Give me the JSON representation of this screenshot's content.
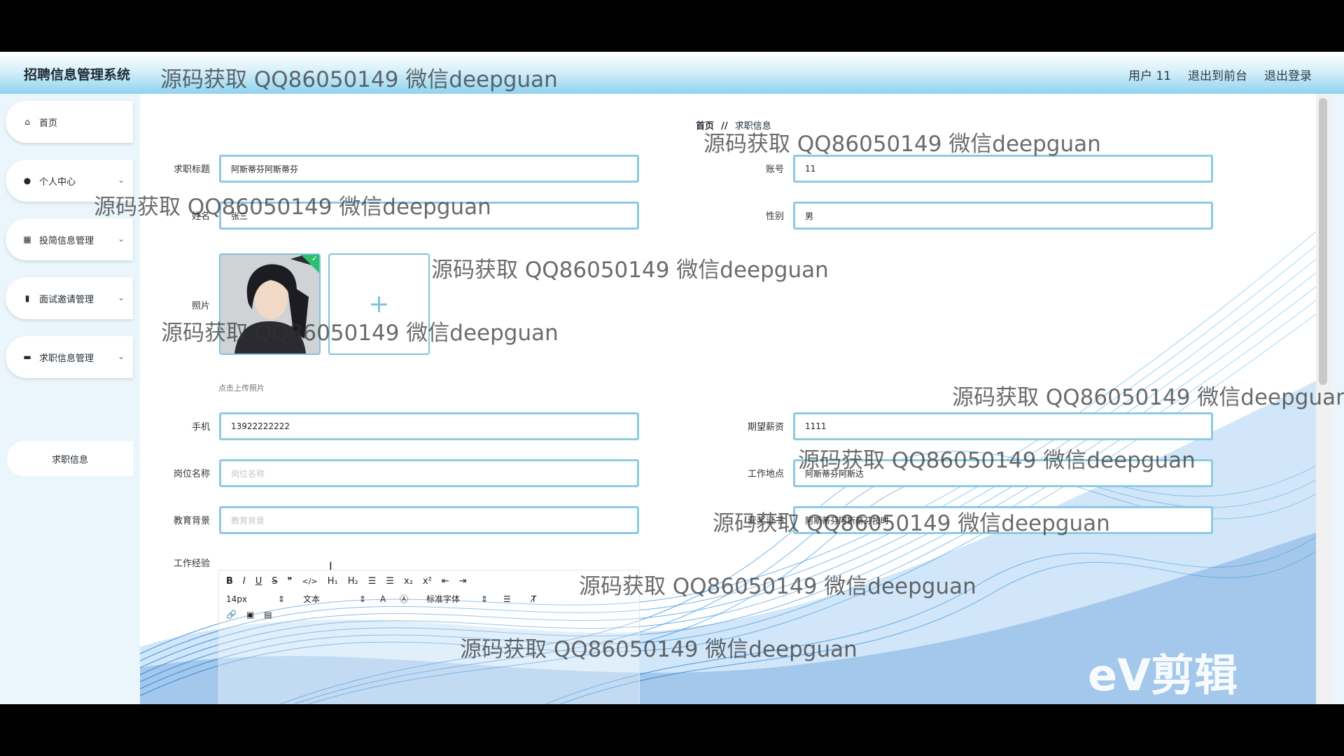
{
  "app": {
    "title": "招聘信息管理系统",
    "nav": [
      "用户 11",
      "退出到前台",
      "退出登录"
    ]
  },
  "sidebar": {
    "items": [
      {
        "icon": "home-icon",
        "glyph": "⌂",
        "label": "首页",
        "has_chevron": false
      },
      {
        "icon": "user-icon",
        "glyph": "●",
        "label": "个人中心",
        "has_chevron": true
      },
      {
        "icon": "grid-icon",
        "glyph": "▦",
        "label": "投简信息管理",
        "has_chevron": true
      },
      {
        "icon": "bar-chart-icon",
        "glyph": "▮",
        "label": "面试邀请管理",
        "has_chevron": true
      },
      {
        "icon": "chat-icon",
        "glyph": "▬",
        "label": "求职信息管理",
        "has_chevron": true
      }
    ],
    "subitem": "求职信息"
  },
  "breadcrumb": {
    "home": "首页",
    "sep": "//",
    "current": "求职信息"
  },
  "form": {
    "title_label": "求职标题",
    "title_value": "阿斯蒂芬阿斯蒂芬",
    "account_label": "账号",
    "account_value": "11",
    "name_label": "姓名",
    "name_value": "张三",
    "gender_label": "性别",
    "gender_value": "男",
    "photo_label": "照片",
    "photo_hint": "点击上传照片",
    "upload_plus": "+",
    "phone_label": "手机",
    "phone_value": "13922222222",
    "salary_label": "期望薪资",
    "salary_value": "1111",
    "position_label": "岗位名称",
    "position_placeholder": "岗位名称",
    "location_label": "工作地点",
    "location_value": "阿斯蒂芬阿斯达",
    "education_label": "教育背景",
    "education_placeholder": "教育背景",
    "award_label": "获奖证书",
    "award_value": "阿斯蒂芬阿斯蒂芬按时",
    "experience_label": "工作经验"
  },
  "editor": {
    "row1": [
      "B",
      "I",
      "U",
      "S",
      "❞",
      "</>",
      "H₁",
      "H₂",
      "☰",
      "☰",
      "x₂",
      "x²",
      "⇤",
      "⇥"
    ],
    "font_size": "14px",
    "header": "文本",
    "font": "标准字体",
    "row3": [
      "🔗",
      "▣",
      "▤"
    ]
  },
  "watermark": "源码获取 QQ86050149 微信deepguan",
  "video_logo": "eV剪辑",
  "colors": {
    "accent": "#8ccbe0",
    "topbar": "#8fd3ef",
    "wave": "#2e8fe0"
  }
}
